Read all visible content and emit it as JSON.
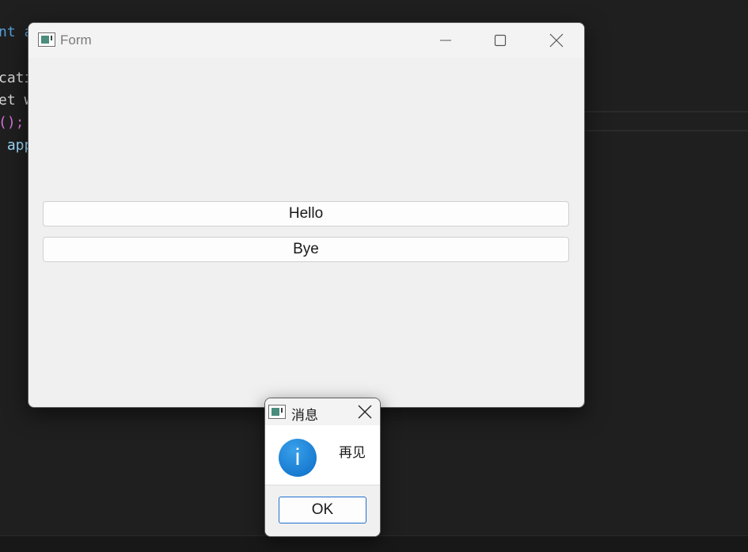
{
  "editor": {
    "lines": [
      {
        "text": "nt a",
        "kind": "kw"
      },
      {
        "text": "cati",
        "kind": "id"
      },
      {
        "text": "et w",
        "kind": "id"
      },
      {
        "text": "();",
        "kind": "paren"
      },
      {
        "text": " app",
        "kind": "var"
      }
    ]
  },
  "form": {
    "title": "Form",
    "icon": "app-window-icon",
    "controls": {
      "minimize": "minimize-icon",
      "maximize": "maximize-icon",
      "close": "close-icon"
    },
    "buttons": [
      {
        "label": "Hello"
      },
      {
        "label": "Bye"
      }
    ]
  },
  "message_box": {
    "title": "消息",
    "icon": "info-icon",
    "icon_glyph": "i",
    "text": "再见",
    "ok_label": "OK"
  }
}
